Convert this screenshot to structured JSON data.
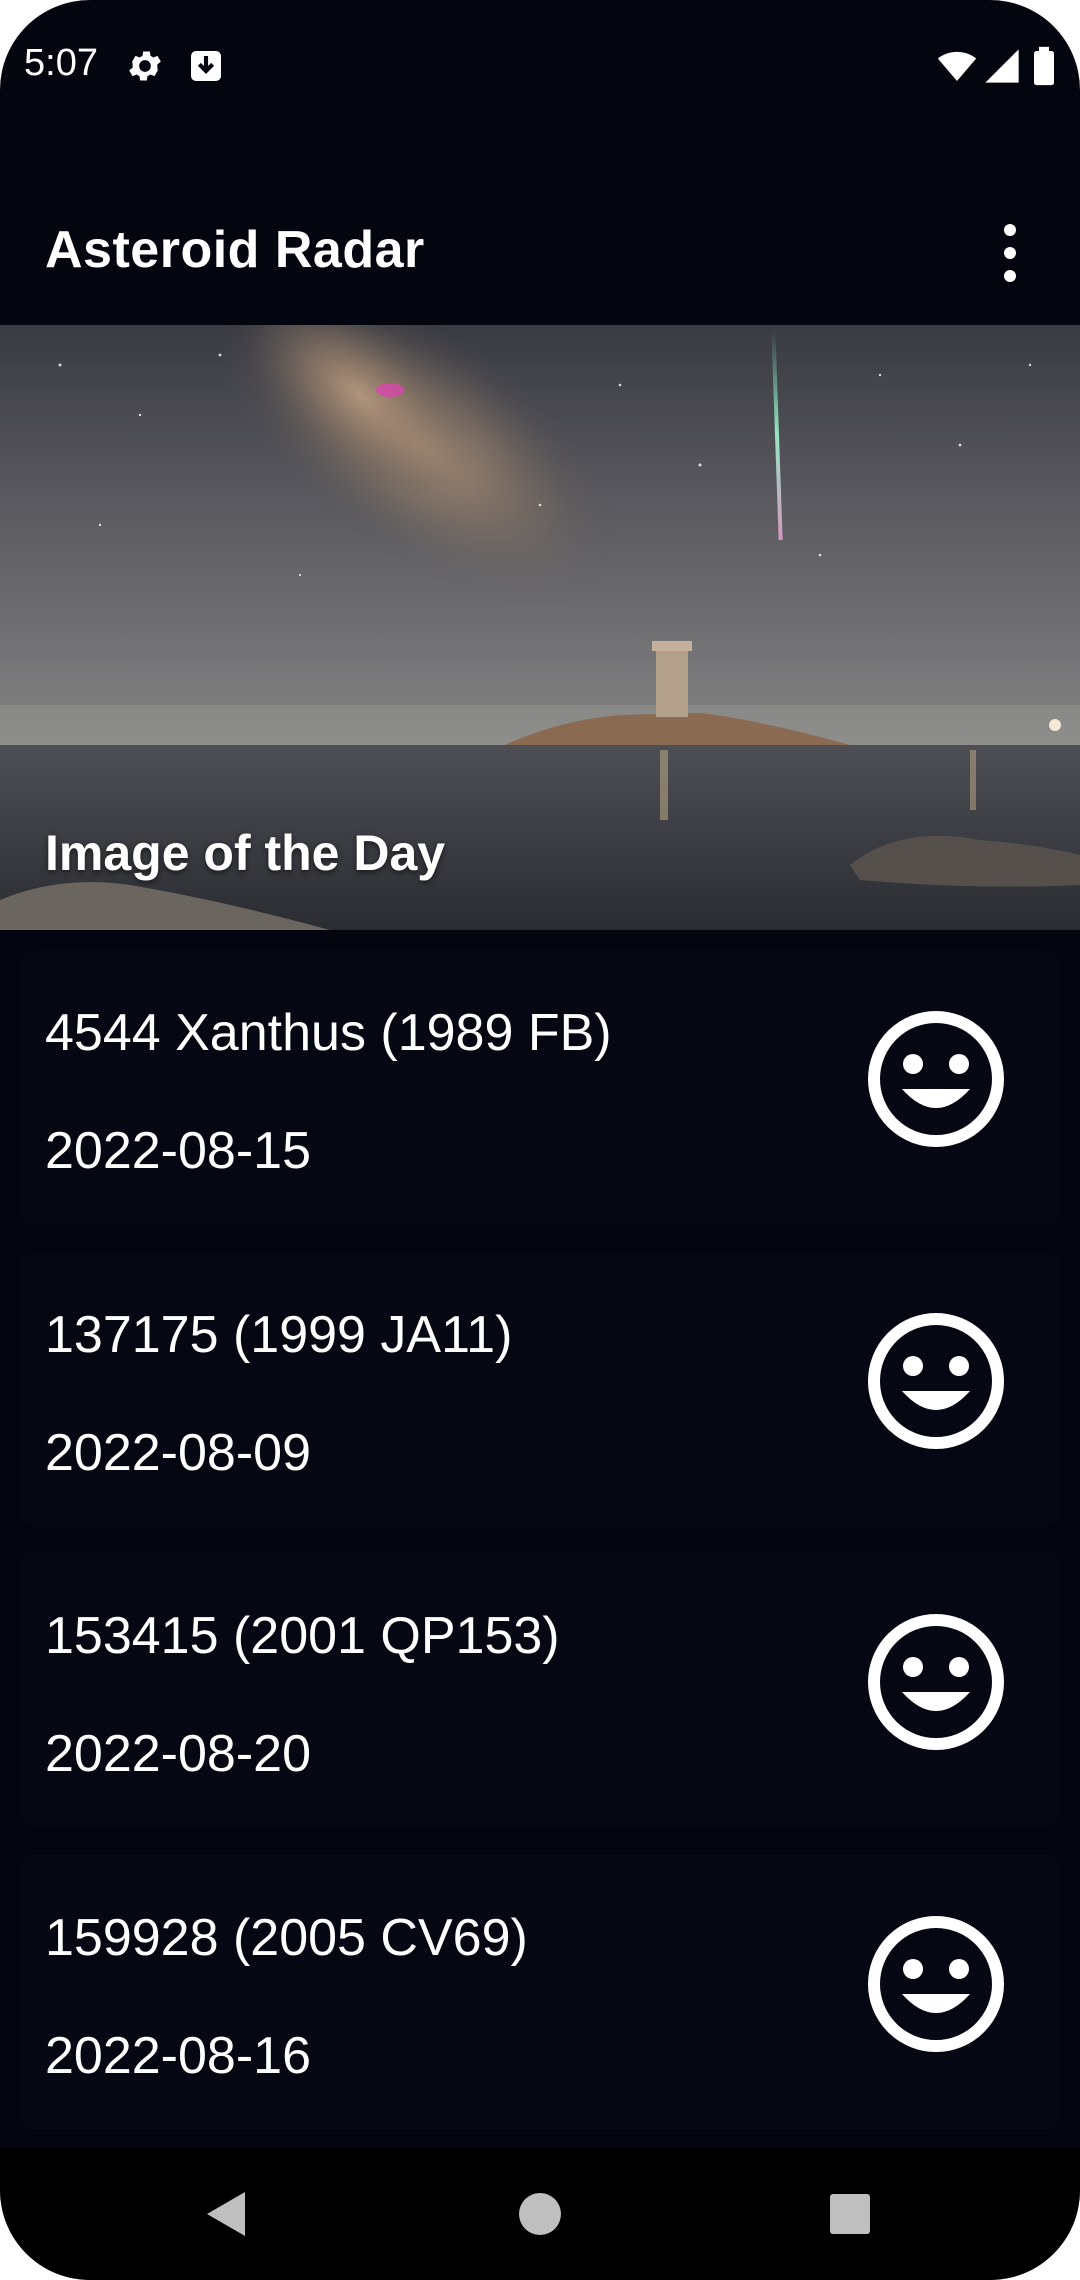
{
  "status_bar": {
    "time": "5:07",
    "icons": [
      "gear-icon",
      "download-icon",
      "wifi-icon",
      "signal-icon",
      "battery-icon"
    ]
  },
  "app_bar": {
    "title": "Asteroid Radar",
    "menu_icon": "more-vert-icon"
  },
  "hero": {
    "caption": "Image of the Day"
  },
  "asteroids": [
    {
      "name": "4544 Xanthus (1989 FB)",
      "date": "2022-08-15",
      "status_icon": "smiley-icon"
    },
    {
      "name": "137175 (1999 JA11)",
      "date": "2022-08-09",
      "status_icon": "smiley-icon"
    },
    {
      "name": "153415 (2001 QP153)",
      "date": "2022-08-20",
      "status_icon": "smiley-icon"
    },
    {
      "name": "159928 (2005 CV69)",
      "date": "2022-08-16",
      "status_icon": "smiley-icon"
    }
  ],
  "nav_bar": {
    "buttons": [
      "back-icon",
      "home-icon",
      "recents-icon"
    ]
  },
  "colors": {
    "background": "#04060f",
    "nav_background": "#000000",
    "text": "#ffffff"
  }
}
